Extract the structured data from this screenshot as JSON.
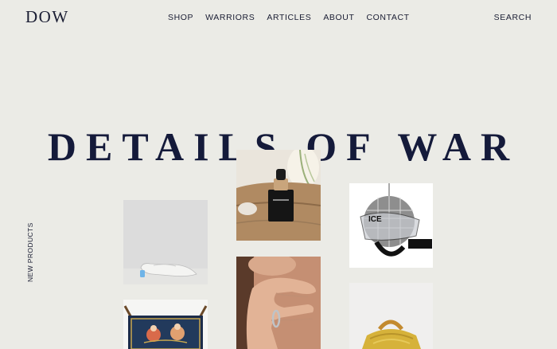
{
  "header": {
    "logo": "DOW",
    "nav": [
      "SHOP",
      "WARRIORS",
      "ARTICLES",
      "ABOUT",
      "CONTACT"
    ],
    "search": "SEARCH"
  },
  "hero": {
    "title": "DETAILS OF WAR"
  },
  "side_label": "NEW PRODUCTS",
  "products": [
    {
      "name": "white-slide-shoe"
    },
    {
      "name": "serum-bottle"
    },
    {
      "name": "disco-helmet"
    },
    {
      "name": "hand-ring"
    },
    {
      "name": "tapestry"
    },
    {
      "name": "yellow-fur-bag"
    }
  ]
}
